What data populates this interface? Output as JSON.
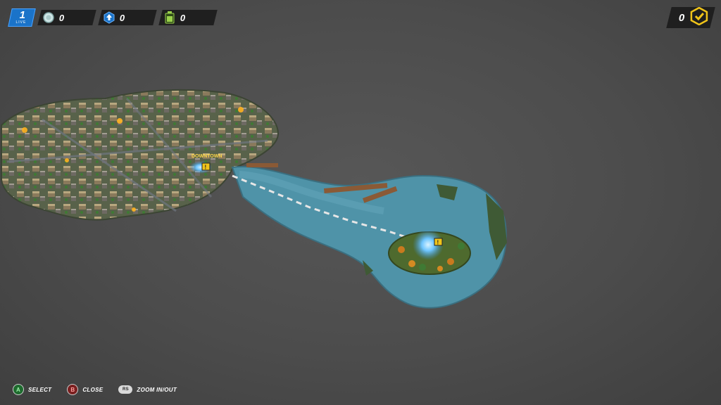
{
  "hud": {
    "lives": "1",
    "lives_label": "LIVE",
    "coins": "0",
    "upgrades": "0",
    "batteries": "0",
    "completed": "0"
  },
  "map": {
    "location_label": "DOWNTOWN"
  },
  "controls": [
    {
      "button": "A",
      "label": "SELECT"
    },
    {
      "button": "B",
      "label": "CLOSE"
    },
    {
      "button": "RS",
      "label": "ZOOM IN/OUT"
    }
  ],
  "colors": {
    "water": "#4f93a8",
    "accent_blue": "#1a73c9",
    "accent_yellow": "#f0c419",
    "land": "#5d6b43"
  }
}
